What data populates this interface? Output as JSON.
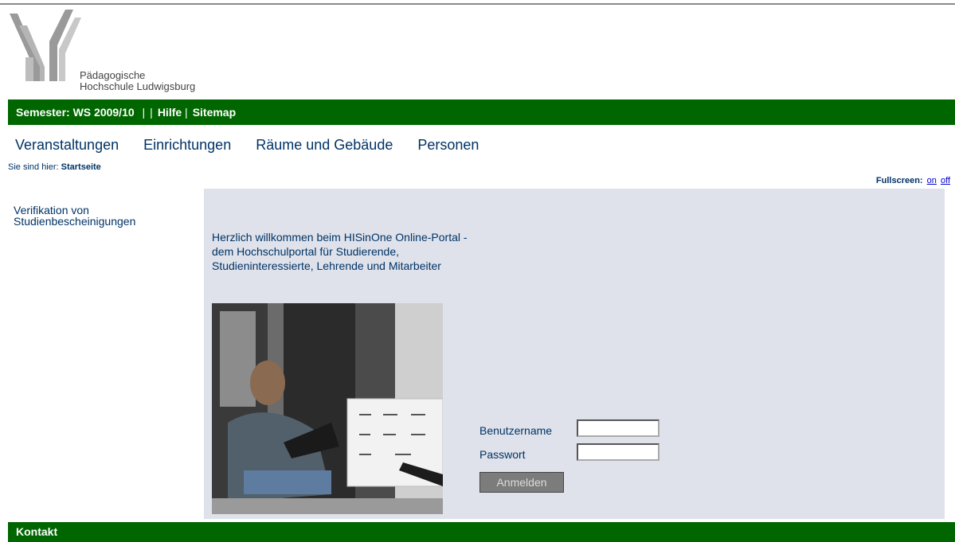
{
  "header": {
    "logo_line1": "Pädagogische",
    "logo_line2": "Hochschule Ludwigsburg"
  },
  "topbar": {
    "semester": "Semester: WS 2009/10",
    "sep1": "|",
    "sep2": "|",
    "hilfe": "Hilfe",
    "sep3": "|",
    "sitemap": "Sitemap"
  },
  "nav": {
    "items": [
      "Veranstaltungen",
      "Einrichtungen",
      "Räume und Gebäude",
      "Personen"
    ]
  },
  "breadcrumb": {
    "prefix": "Sie sind hier:",
    "current": "Startseite"
  },
  "fullscreen": {
    "label": "Fullscreen:",
    "on": "on",
    "off": "off"
  },
  "sidebar": {
    "link": "Verifikation von Studienbescheinigungen"
  },
  "main": {
    "welcome": "Herzlich willkommen beim HISinOne Online-Portal - dem Hochschulportal für Studierende, Studieninteressierte, Lehrende und Mitarbeiter"
  },
  "login": {
    "username_label": "Benutzername",
    "username_value": "",
    "password_label": "Passwort",
    "password_value": "",
    "submit": "Anmelden"
  },
  "footer": {
    "label": "Kontakt"
  },
  "colors": {
    "green_bar": "#006600",
    "content_bg": "#dfe2ea",
    "text": "#003366"
  }
}
